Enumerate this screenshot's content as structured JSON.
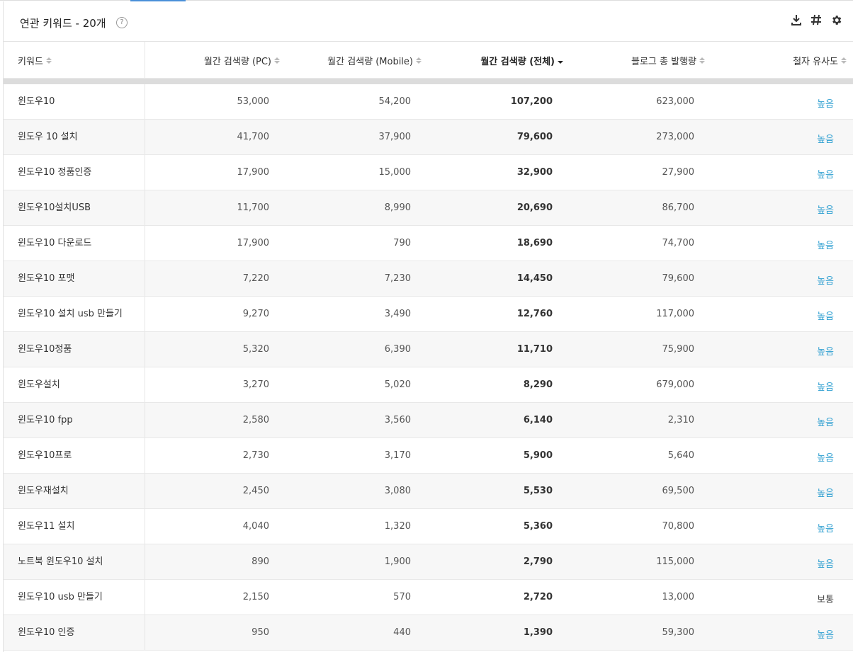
{
  "panel": {
    "title": "연관 키워드 - 20개",
    "help_glyph": "?"
  },
  "columns": {
    "keyword": "키워드",
    "pc": "월간 검색량 (PC)",
    "mobile": "월간 검색량 (Mobile)",
    "total": "월간 검색량 (전체)",
    "blog": "블로그 총 발행량",
    "similarity": "철자 유사도"
  },
  "rows": [
    {
      "keyword": "윈도우10",
      "pc": "53,000",
      "mobile": "54,200",
      "total": "107,200",
      "blog": "623,000",
      "similarity": "높음"
    },
    {
      "keyword": "윈도우 10 설치",
      "pc": "41,700",
      "mobile": "37,900",
      "total": "79,600",
      "blog": "273,000",
      "similarity": "높음"
    },
    {
      "keyword": "윈도우10 정품인증",
      "pc": "17,900",
      "mobile": "15,000",
      "total": "32,900",
      "blog": "27,900",
      "similarity": "높음"
    },
    {
      "keyword": "윈도우10설치USB",
      "pc": "11,700",
      "mobile": "8,990",
      "total": "20,690",
      "blog": "86,700",
      "similarity": "높음"
    },
    {
      "keyword": "윈도우10 다운로드",
      "pc": "17,900",
      "mobile": "790",
      "total": "18,690",
      "blog": "74,700",
      "similarity": "높음"
    },
    {
      "keyword": "윈도우10 포맷",
      "pc": "7,220",
      "mobile": "7,230",
      "total": "14,450",
      "blog": "79,600",
      "similarity": "높음"
    },
    {
      "keyword": "윈도우10 설치 usb 만들기",
      "pc": "9,270",
      "mobile": "3,490",
      "total": "12,760",
      "blog": "117,000",
      "similarity": "높음"
    },
    {
      "keyword": "윈도우10정품",
      "pc": "5,320",
      "mobile": "6,390",
      "total": "11,710",
      "blog": "75,900",
      "similarity": "높음"
    },
    {
      "keyword": "윈도우설치",
      "pc": "3,270",
      "mobile": "5,020",
      "total": "8,290",
      "blog": "679,000",
      "similarity": "높음"
    },
    {
      "keyword": "윈도우10 fpp",
      "pc": "2,580",
      "mobile": "3,560",
      "total": "6,140",
      "blog": "2,310",
      "similarity": "높음"
    },
    {
      "keyword": "윈도우10프로",
      "pc": "2,730",
      "mobile": "3,170",
      "total": "5,900",
      "blog": "5,640",
      "similarity": "높음"
    },
    {
      "keyword": "윈도우재설치",
      "pc": "2,450",
      "mobile": "3,080",
      "total": "5,530",
      "blog": "69,500",
      "similarity": "높음"
    },
    {
      "keyword": "윈도우11 설치",
      "pc": "4,040",
      "mobile": "1,320",
      "total": "5,360",
      "blog": "70,800",
      "similarity": "높음"
    },
    {
      "keyword": "노트북 윈도우10 설치",
      "pc": "890",
      "mobile": "1,900",
      "total": "2,790",
      "blog": "115,000",
      "similarity": "높음"
    },
    {
      "keyword": "윈도우10 usb 만들기",
      "pc": "2,150",
      "mobile": "570",
      "total": "2,720",
      "blog": "13,000",
      "similarity": "보통"
    },
    {
      "keyword": "윈도우10 인증",
      "pc": "950",
      "mobile": "440",
      "total": "1,390",
      "blog": "59,300",
      "similarity": "높음"
    }
  ],
  "colors": {
    "accent": "#4a90d9",
    "link": "#2e9fd1"
  },
  "icons": [
    "download-icon",
    "hashtag-icon",
    "gear-icon",
    "help-icon",
    "sort-icon"
  ]
}
